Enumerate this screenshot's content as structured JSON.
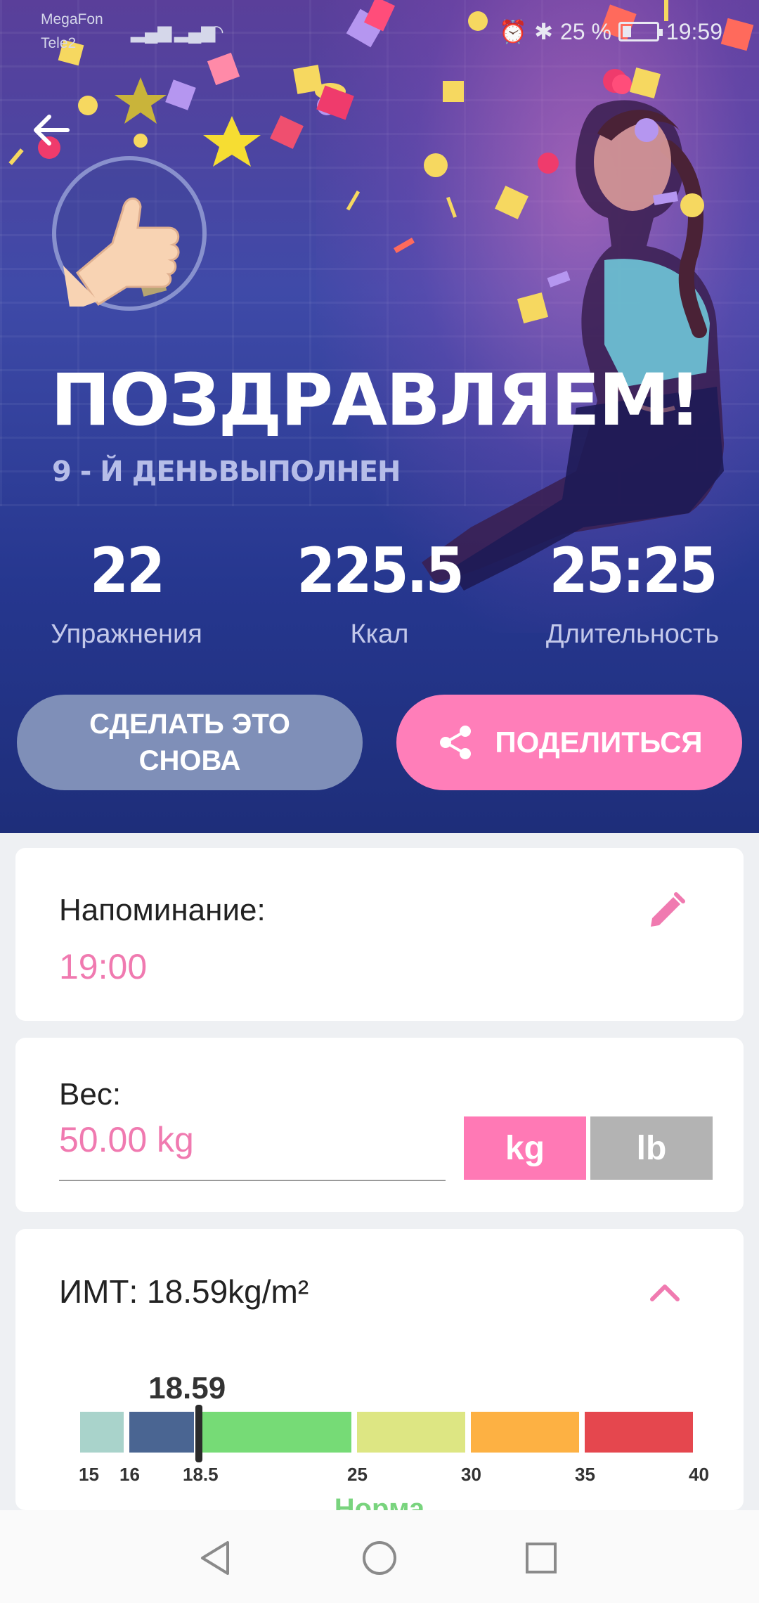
{
  "status_bar": {
    "carrier1": "MegaFon",
    "carrier2": "Tele2",
    "battery": "25 %",
    "time": "19:59"
  },
  "hero": {
    "title": "ПОЗДРАВЛЯЕМ!",
    "subtitle": "9  - Й ДЕНЬВЫПОЛНЕН",
    "stats": [
      {
        "value": "22",
        "label": "Упражнения"
      },
      {
        "value": "225.5",
        "label": "Ккал"
      },
      {
        "value": "25:25",
        "label": "Длительность"
      }
    ],
    "again_label": "СДЕЛАТЬ ЭТО СНОВА",
    "share_label": "ПОДЕЛИТЬСЯ"
  },
  "reminder": {
    "label": "Напоминание:",
    "time": "19:00"
  },
  "weight": {
    "label": "Вес:",
    "value": "50.00 kg",
    "unit_kg": "kg",
    "unit_lb": "lb",
    "selected_unit": "kg"
  },
  "bmi": {
    "label": "ИМТ:  18.59kg/m²",
    "value": "18.59",
    "ticks": [
      "15",
      "16",
      "18.5",
      "25",
      "30",
      "35",
      "40"
    ],
    "category": "Норма"
  },
  "colors": {
    "accent_pink": "#ff7eb9",
    "bmi_segments": [
      "#a9d3cb",
      "#4a6592",
      "#76db76",
      "#dde683",
      "#fdb143",
      "#e5474e"
    ]
  },
  "icons": {
    "back": "arrow-left-icon",
    "share": "share-icon",
    "edit": "pencil-icon",
    "collapse": "chevron-up-icon"
  }
}
